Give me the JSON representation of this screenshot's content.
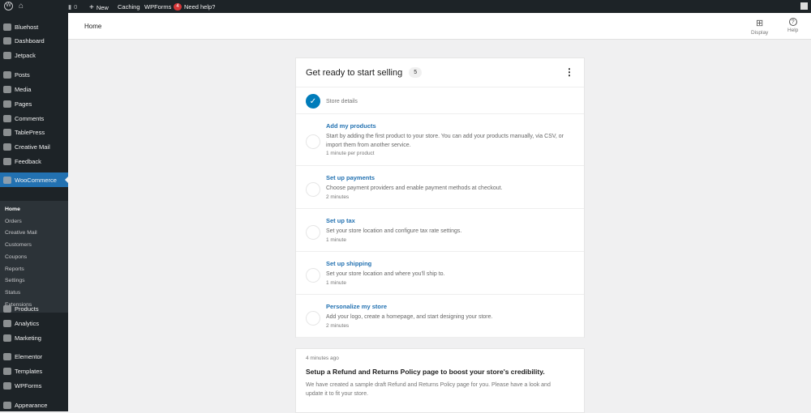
{
  "adminbar": {
    "comments_count": "0",
    "new": "New",
    "caching": "Caching",
    "wpforms": "WPForms",
    "wpforms_badge": "4",
    "help": "Need help?"
  },
  "sidebar": {
    "items": [
      "Bluehost",
      "Dashboard",
      "Jetpack",
      "Posts",
      "Media",
      "Pages",
      "Comments",
      "TablePress",
      "Creative Mail",
      "Feedback",
      "WooCommerce"
    ],
    "submenu": [
      "Home",
      "Orders",
      "Creative Mail",
      "Customers",
      "Coupons",
      "Reports",
      "Settings",
      "Status",
      "Extensions"
    ],
    "items2": [
      "Products",
      "Analytics",
      "Marketing",
      "Elementor",
      "Templates",
      "WPForms",
      "Appearance"
    ]
  },
  "header": {
    "title": "Home",
    "display": "Display",
    "help": "Help"
  },
  "setup": {
    "title": "Get ready to start selling",
    "count": "5",
    "store_details": "Store details",
    "tasks": [
      {
        "title": "Add my products",
        "desc": "Start by adding the first product to your store. You can add your products manually, via CSV, or import them from another service.",
        "time": "1 minute per product"
      },
      {
        "title": "Set up payments",
        "desc": "Choose payment providers and enable payment methods at checkout.",
        "time": "2 minutes"
      },
      {
        "title": "Set up tax",
        "desc": "Set your store location and configure tax rate settings.",
        "time": "1 minute"
      },
      {
        "title": "Set up shipping",
        "desc": "Set your store location and where you'll ship to.",
        "time": "1 minute"
      },
      {
        "title": "Personalize my store",
        "desc": "Add your logo, create a homepage, and start designing your store.",
        "time": "2 minutes"
      }
    ]
  },
  "notice": {
    "time": "4 minutes ago",
    "title": "Setup a Refund and Returns Policy page to boost your store's credibility.",
    "body": "We have created a sample draft Refund and Returns Policy page for you. Please have a look and update it to fit your store."
  }
}
